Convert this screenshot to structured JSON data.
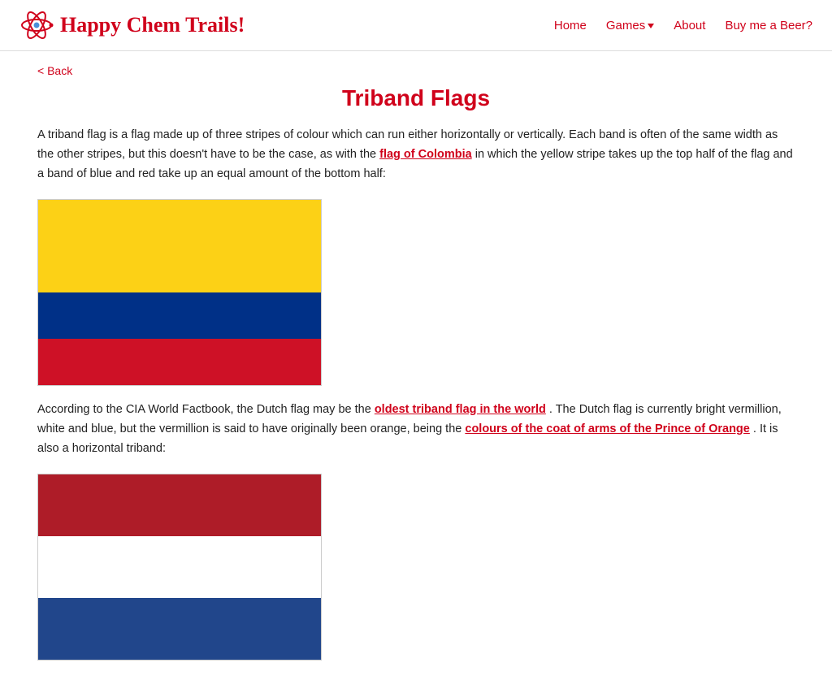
{
  "header": {
    "logo_text": "Happy Chem Trails!",
    "nav": {
      "home": "Home",
      "games": "Games",
      "about": "About",
      "buy_beer": "Buy me a Beer?"
    }
  },
  "page": {
    "back_label": "< Back",
    "title": "Triband Flags",
    "intro_paragraph": "A triband flag is a flag made up of three stripes of colour which can run either horizontally or vertically. Each band is often of the same width as the other stripes, but this doesn't have to be the case, as with the",
    "intro_link_text": "flag of Colombia",
    "intro_paragraph_end": " in which the yellow stripe takes up the top half of the flag and a band of blue and red take up an equal amount of the bottom half:",
    "second_paragraph_start": "According to the CIA World Factbook, the Dutch flag may be the",
    "second_link1_text": "oldest triband flag in the world",
    "second_paragraph_mid": ". The Dutch flag is currently bright vermillion, white and blue, but the vermillion is said to have originally been orange, being the",
    "second_link2_text": "colours of the coat of arms of the Prince of Orange",
    "second_paragraph_end": ". It is also a horizontal triband:"
  }
}
